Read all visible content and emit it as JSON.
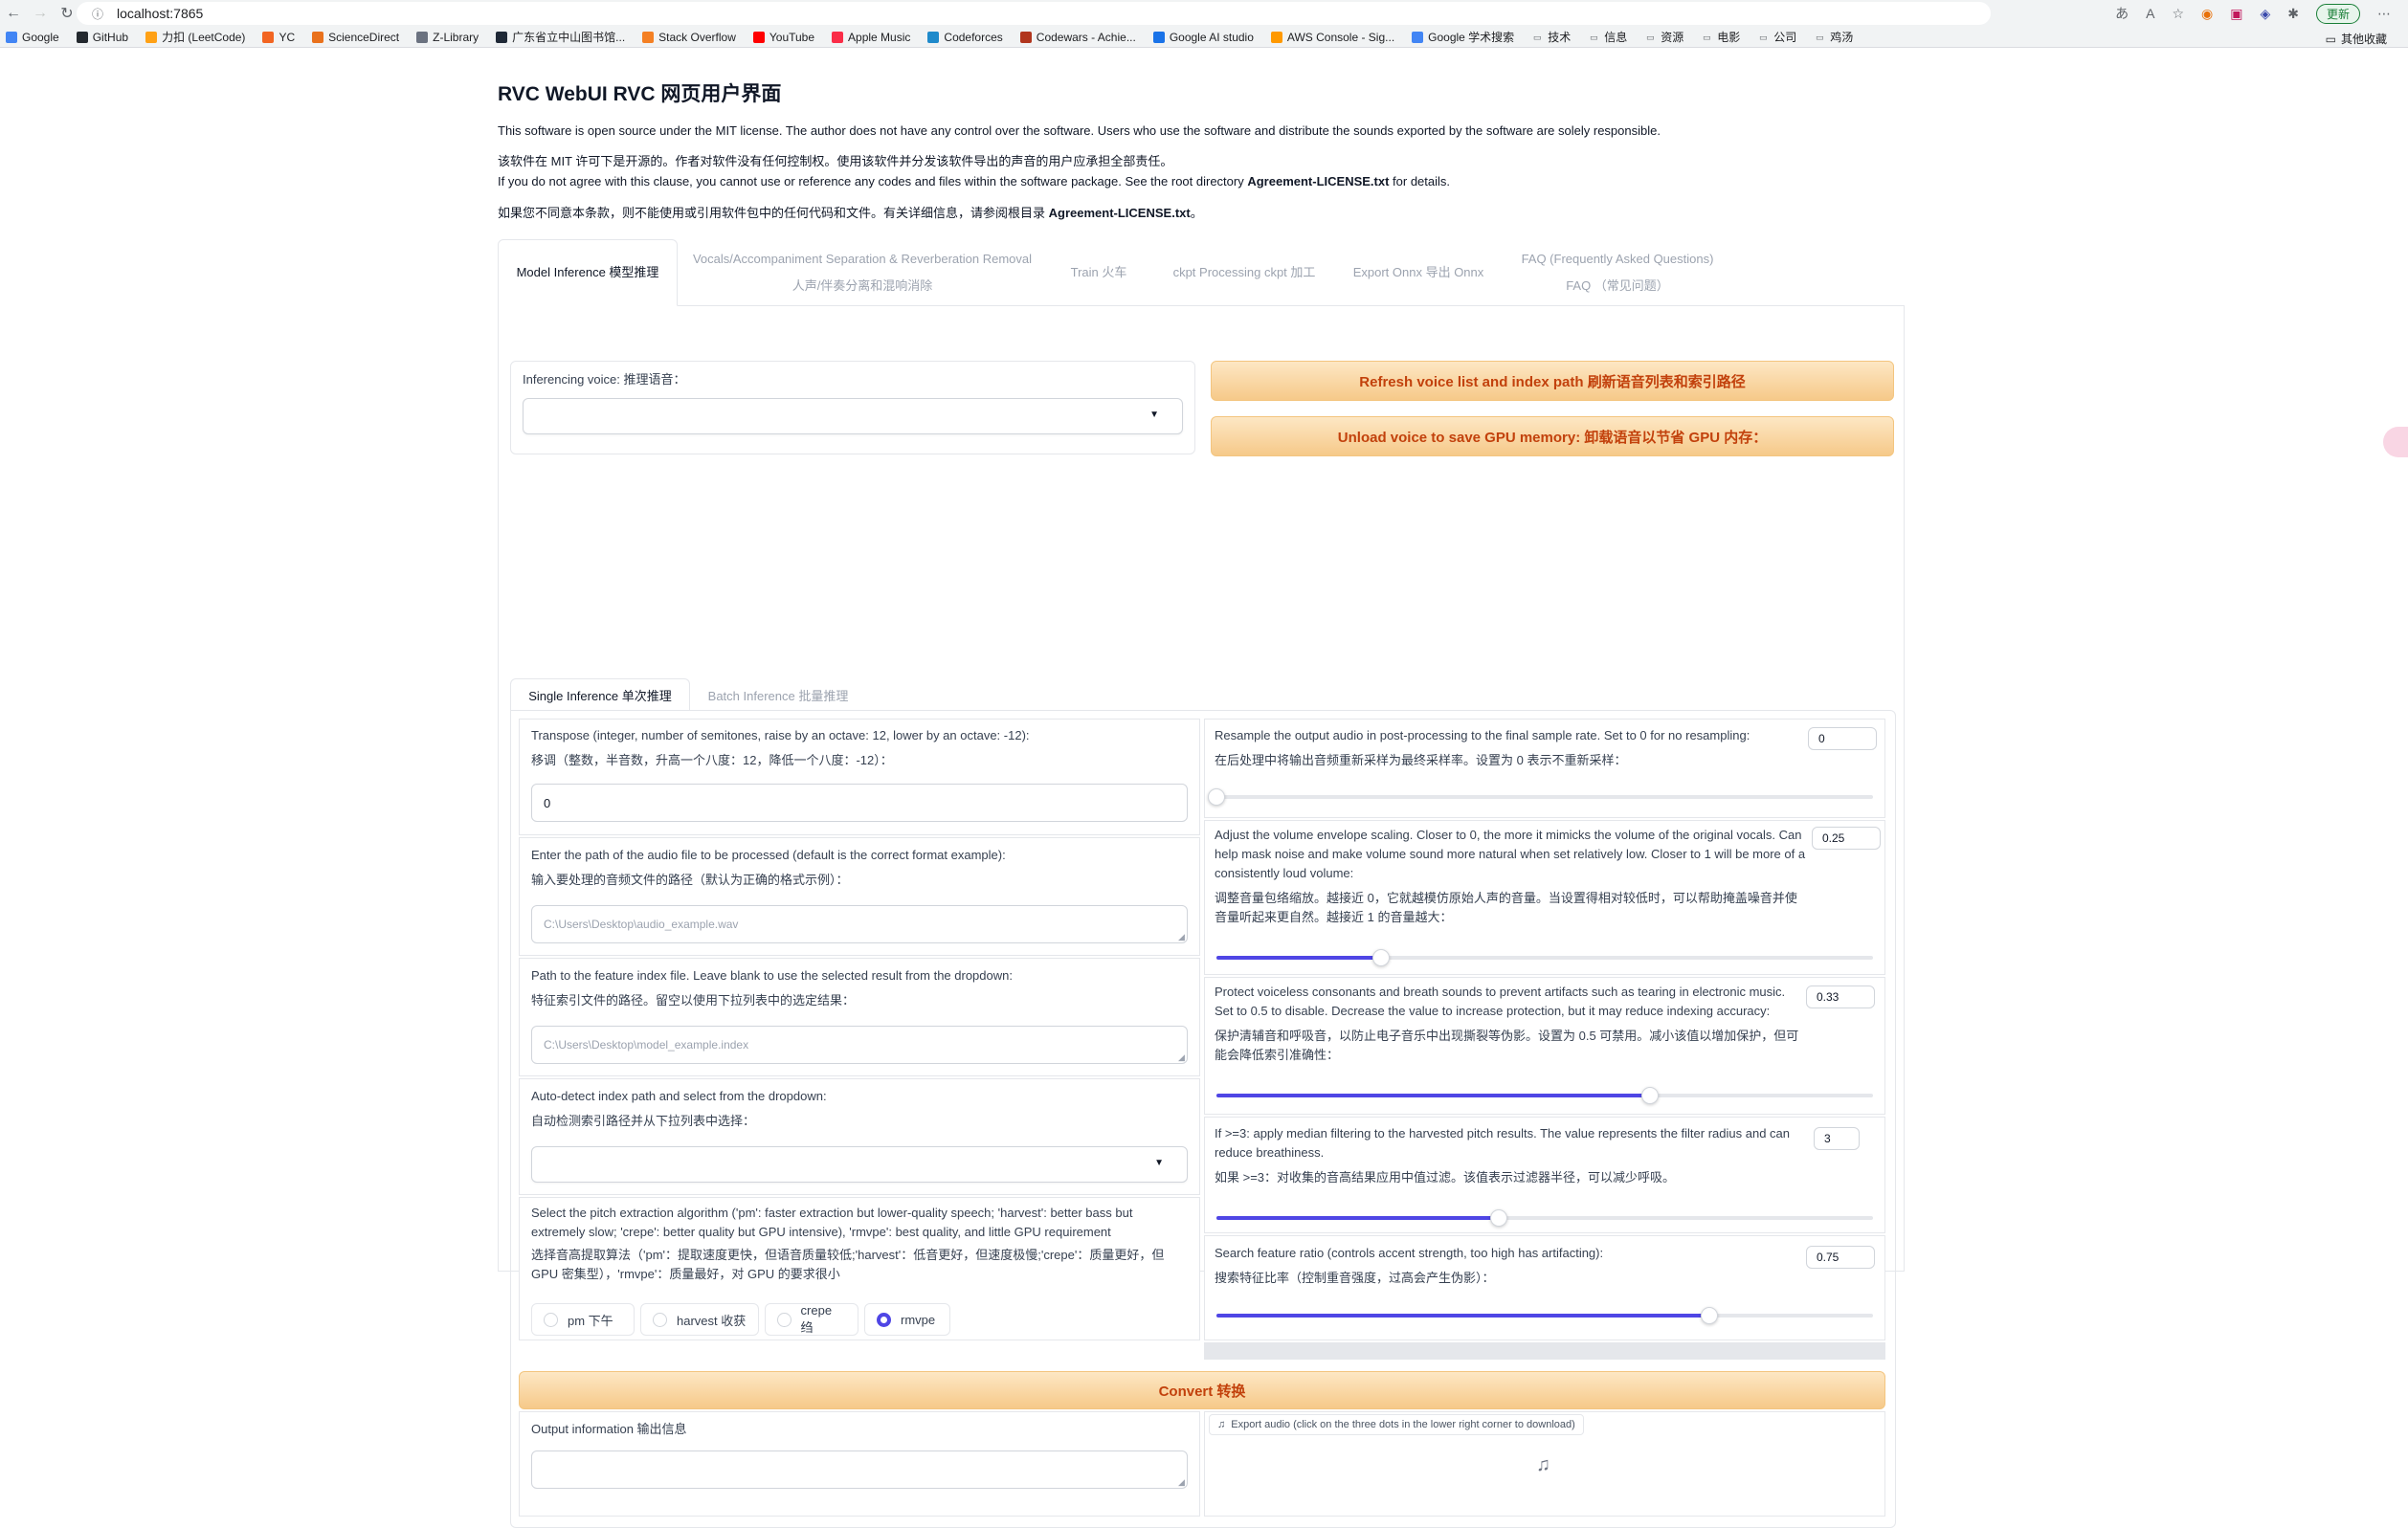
{
  "browser": {
    "url": "localhost:7865",
    "update_label": "更新",
    "bookmarks": [
      {
        "label": "Google",
        "color": "#4285f4"
      },
      {
        "label": "GitHub",
        "color": "#24292f"
      },
      {
        "label": "力扣 (LeetCode)",
        "color": "#ffa116"
      },
      {
        "label": "YC",
        "color": "#f26522"
      },
      {
        "label": "ScienceDirect",
        "color": "#e9711c"
      },
      {
        "label": "Z-Library",
        "color": "#6b7280"
      },
      {
        "label": "广东省立中山图书馆...",
        "color": "#1f2937"
      },
      {
        "label": "Stack Overflow",
        "color": "#f48024"
      },
      {
        "label": "YouTube",
        "color": "#ff0000"
      },
      {
        "label": "Apple Music",
        "color": "#fa2d48"
      },
      {
        "label": "Codeforces",
        "color": "#1f8acb"
      },
      {
        "label": "Codewars - Achie...",
        "color": "#b1361e"
      },
      {
        "label": "Google AI studio",
        "color": "#1a73e8"
      },
      {
        "label": "AWS Console - Sig...",
        "color": "#ff9900"
      },
      {
        "label": "Google 学术搜索",
        "color": "#4285f4"
      },
      {
        "label": "技术",
        "color": "folder"
      },
      {
        "label": "信息",
        "color": "folder"
      },
      {
        "label": "资源",
        "color": "folder"
      },
      {
        "label": "电影",
        "color": "folder"
      },
      {
        "label": "公司",
        "color": "folder"
      },
      {
        "label": "鸡汤",
        "color": "folder"
      }
    ],
    "other_bookmarks": "其他收藏"
  },
  "header": {
    "title": "RVC WebUI  RVC 网页用户界面",
    "license_en": "This software is open source under the MIT license. The author does not have any control over the software. Users who use the software and distribute the sounds exported by the software are solely responsible.",
    "license_cn": "该软件在 MIT 许可下是开源的。作者对软件没有任何控制权。使用该软件并分发该软件导出的声音的用户应承担全部责任。",
    "clause_en_prefix": "If you do not agree with this clause, you cannot use or reference any codes and files within the software package. See the root directory ",
    "clause_en_file": "Agreement-LICENSE.txt",
    "clause_en_suffix": " for details.",
    "clause_cn_prefix": "如果您不同意本条款，则不能使用或引用软件包中的任何代码和文件。有关详细信息，请参阅根目录 ",
    "clause_cn_file": "Agreement-LICENSE.txt",
    "clause_cn_suffix": "。"
  },
  "tabs": [
    {
      "line1": "Model Inference  模型推理",
      "line2": ""
    },
    {
      "line1": "Vocals/Accompaniment Separation & Reverberation Removal",
      "line2": "人声/伴奏分离和混响消除"
    },
    {
      "line1": "Train  火车",
      "line2": ""
    },
    {
      "line1": "ckpt Processing  ckpt 加工",
      "line2": ""
    },
    {
      "line1": "Export Onnx  导出 Onnx",
      "line2": ""
    },
    {
      "line1": "FAQ (Frequently Asked Questions)",
      "line2": "FAQ （常见问题）"
    }
  ],
  "voice": {
    "label": "Inferencing voice:  推理语音：",
    "value": "",
    "refresh_button": "Refresh voice list and index path  刷新语音列表和索引路径",
    "unload_button": "Unload voice to save GPU memory:  卸载语音以节省 GPU 内存："
  },
  "subtabs": [
    "Single Inference  单次推理",
    "Batch Inference  批量推理"
  ],
  "left": {
    "transpose_en": "Transpose (integer, number of semitones, raise by an octave: 12, lower by an octave: -12):",
    "transpose_cn": "移调（整数，半音数，升高一个八度：12，降低一个八度：-12）：",
    "transpose_value": "0",
    "audio_path_en": "Enter the path of the audio file to be processed (default is the correct format example):",
    "audio_path_cn": "输入要处理的音频文件的路径（默认为正确的格式示例）：",
    "audio_path_placeholder": "C:\\Users\\Desktop\\audio_example.wav",
    "index_path_en": "Path to the feature index file. Leave blank to use the selected result from the dropdown:",
    "index_path_cn": "特征索引文件的路径。留空以使用下拉列表中的选定结果：",
    "index_path_placeholder": "C:\\Users\\Desktop\\model_example.index",
    "auto_index_en": "Auto-detect index path and select from the dropdown:",
    "auto_index_cn": "自动检测索引路径并从下拉列表中选择：",
    "pitch_en": "Select the pitch extraction algorithm ('pm': faster extraction but lower-quality speech; 'harvest': better bass but extremely slow; 'crepe': better quality but GPU intensive), 'rmvpe': best quality, and little GPU requirement",
    "pitch_cn": "选择音高提取算法（'pm'：提取速度更快，但语音质量较低;'harvest'：低音更好，但速度极慢;'crepe'：质量更好，但 GPU 密集型），'rmvpe'：质量最好，对 GPU 的要求很小",
    "pitch_options": [
      "pm  下午",
      "harvest  收获",
      "crepe  绉",
      "rmvpe"
    ],
    "pitch_selected": "rmvpe"
  },
  "right": {
    "resample_en": "Resample the output audio in post-processing to the final sample rate. Set to 0 for no resampling:",
    "resample_cn": "在后处理中将输出音频重新采样为最终采样率。设置为 0 表示不重新采样：",
    "resample_value": "0",
    "resample_fraction": 0.0,
    "volume_en": "Adjust the volume envelope scaling. Closer to 0, the more it mimicks the volume of the original vocals. Can help mask noise and make volume sound more natural when set relatively low. Closer to 1 will be more of a consistently loud volume:",
    "volume_cn": "调整音量包络缩放。越接近 0，它就越模仿原始人声的音量。当设置得相对较低时，可以帮助掩盖噪音并使音量听起来更自然。越接近 1 的音量越大：",
    "volume_value": "0.25",
    "volume_fraction": 0.25,
    "protect_en": "Protect voiceless consonants and breath sounds to prevent artifacts such as tearing in electronic music. Set to 0.5 to disable. Decrease the value to increase protection, but it may reduce indexing accuracy:",
    "protect_cn": "保护清辅音和呼吸音，以防止电子音乐中出现撕裂等伪影。设置为 0.5 可禁用。减小该值以增加保护，但可能会降低索引准确性：",
    "protect_value": "0.33",
    "protect_fraction": 0.66,
    "median_en": "If >=3: apply median filtering to the harvested pitch results. The value represents the filter radius and can reduce breathiness.",
    "median_cn": "如果 >=3：对收集的音高结果应用中值过滤。该值表示过滤器半径，可以减少呼吸。",
    "median_value": "3",
    "median_fraction": 0.43,
    "ratio_en": "Search feature ratio (controls accent strength, too high has artifacting):",
    "ratio_cn": "搜索特征比率（控制重音强度，过高会产生伪影）：",
    "ratio_value": "0.75",
    "ratio_fraction": 0.75
  },
  "convert": {
    "button": "Convert  转换",
    "output_label": "Output information  输出信息",
    "output_value": "",
    "export_label": "Export audio (click on the three dots in the lower right corner to download)"
  },
  "colors": {
    "accent": "#4f46e5",
    "orange_text": "#c2410c",
    "orange_bg": "#f6c989"
  }
}
